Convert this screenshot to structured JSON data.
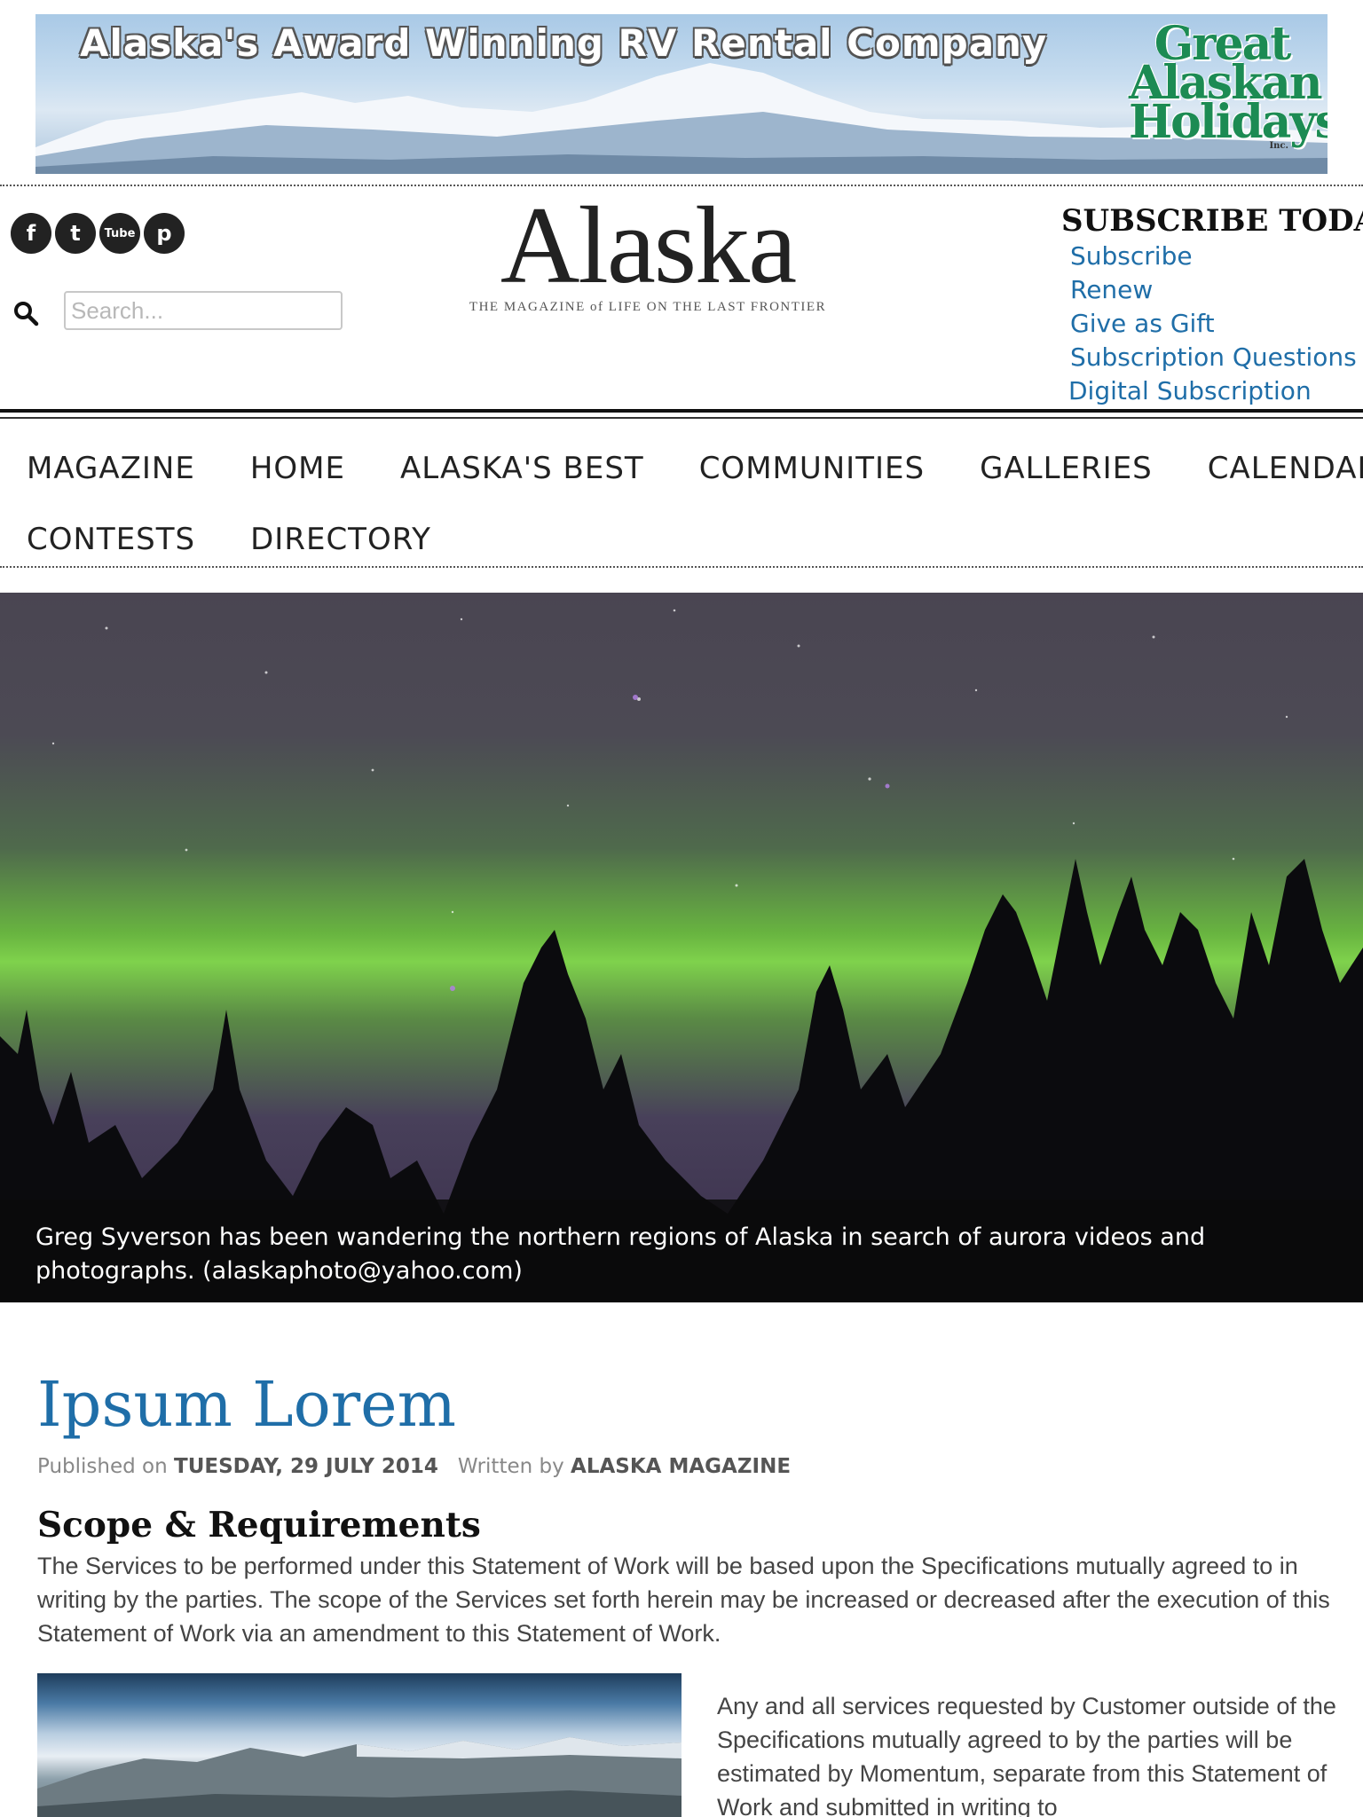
{
  "ad": {
    "headline": "Alaska's Award Winning RV Rental Company",
    "logo_line1": "Great",
    "logo_line2": "Alaskan",
    "logo_line3": "Holidays",
    "logo_suffix": "Inc."
  },
  "social": [
    {
      "icon": "facebook-icon",
      "glyph": "f"
    },
    {
      "icon": "twitter-icon",
      "glyph": "t"
    },
    {
      "icon": "youtube-icon",
      "glyph": "Tube"
    },
    {
      "icon": "pinterest-icon",
      "glyph": "p"
    }
  ],
  "search": {
    "placeholder": "Search..."
  },
  "masthead": {
    "title": "Alaska",
    "tagline": "THE MAGAZINE of LIFE ON THE LAST FRONTIER"
  },
  "subscribe": {
    "heading": "SUBSCRIBE TODAY",
    "links": [
      "Subscribe",
      "Renew",
      "Give as Gift",
      " Subscription Questions",
      "Digital Subscription"
    ]
  },
  "nav": {
    "row1": [
      "MAGAZINE",
      "HOME",
      "ALASKA'S BEST",
      "COMMUNITIES",
      "GALLERIES",
      "CALENDAR"
    ],
    "row2": [
      "CONTESTS",
      "DIRECTORY"
    ]
  },
  "hero": {
    "caption": "Greg Syverson has been wandering the northern regions of Alaska in search of aurora videos and photographs. (alaskaphoto@yahoo.com)"
  },
  "article": {
    "title": "Ipsum Lorem",
    "published_label": "Published on",
    "published_date": "TUESDAY, 29 JULY 2014",
    "written_label": "Written by",
    "author": "ALASKA MAGAZINE",
    "section_heading": "Scope & Requirements",
    "paragraph1": "The Services to be performed under this Statement of Work will be based upon the Specifications mutually agreed to in writing by the parties. The scope of the Services set forth herein may be increased or decreased after the execution of this Statement of Work via an amendment to this Statement of Work.",
    "paragraph2": "Any and all services requested by Customer outside of the Specifications mutually agreed to by the parties will be estimated by Momentum, separate from this Statement of Work and submitted in writing to"
  },
  "colors": {
    "link": "#1f6ea8",
    "title": "#1f6ea8",
    "logo_green": "#1c8b53"
  }
}
